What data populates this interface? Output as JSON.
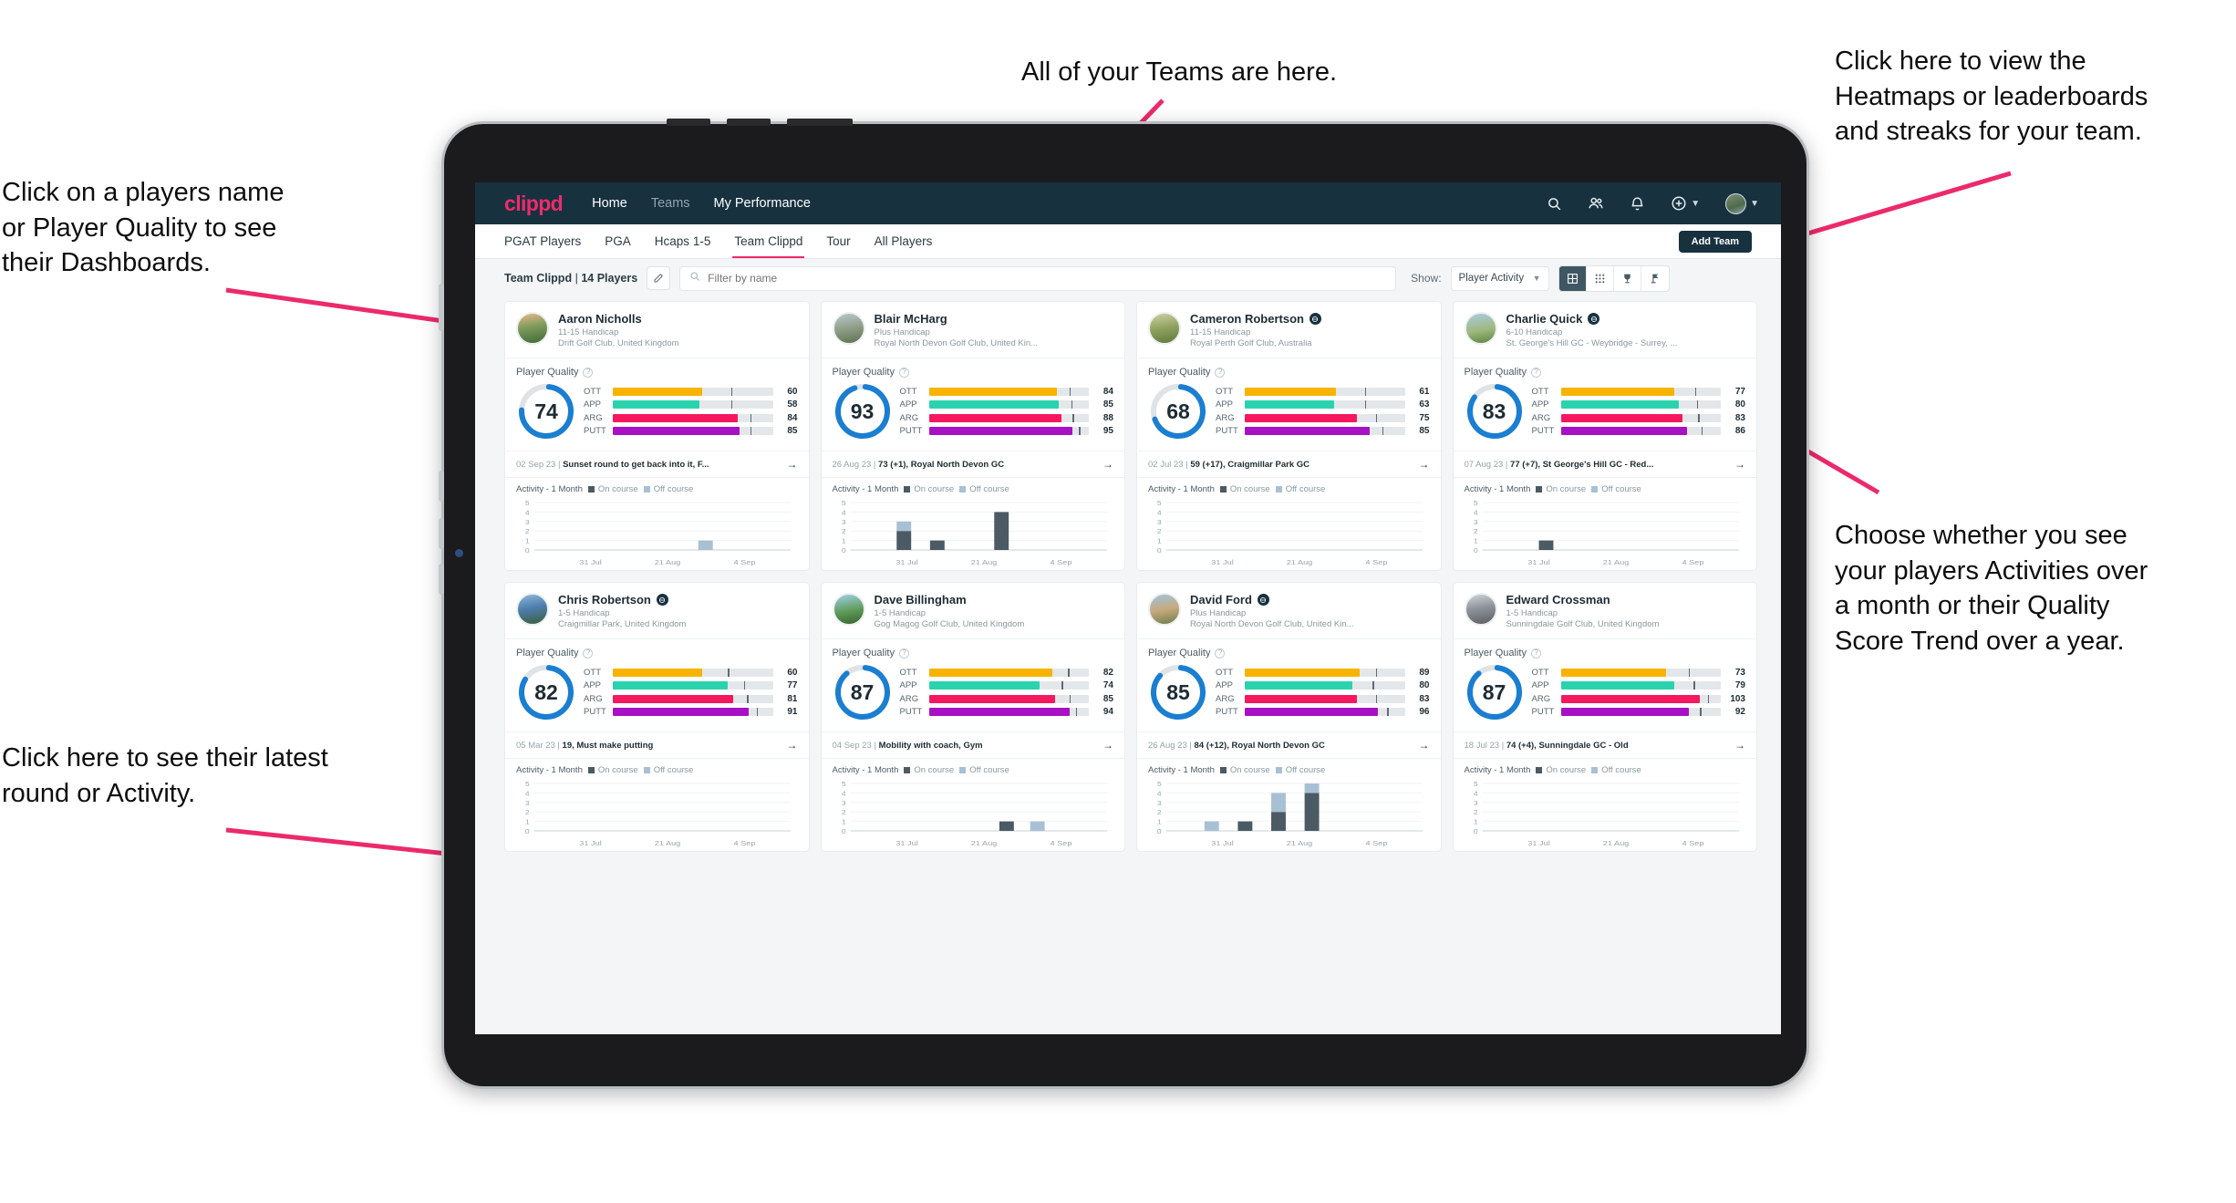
{
  "annotations": [
    {
      "id": "players-name",
      "text": "Click on a players name\nor Player Quality to see\ntheir Dashboards."
    },
    {
      "id": "teams",
      "text": "All of your Teams are here."
    },
    {
      "id": "heatmaps",
      "text": "Click here to view the\nHeatmaps or leaderboards\nand streaks for your team."
    },
    {
      "id": "activity-toggle",
      "text": "Choose whether you see\nyour players Activities over\na month or their Quality\nScore Trend over a year."
    },
    {
      "id": "latest-round",
      "text": "Click here to see their latest\nround or Activity."
    }
  ],
  "app": {
    "logo": "clippd",
    "nav": [
      {
        "label": "Home",
        "active": true
      },
      {
        "label": "Teams",
        "active": false
      },
      {
        "label": "My Performance",
        "active": true
      }
    ],
    "icons": [
      "search-icon",
      "people-icon",
      "bell-icon",
      "plus-circle-icon",
      "avatar"
    ],
    "tabs": [
      {
        "label": "PGAT Players",
        "state": "normal"
      },
      {
        "label": "PGA",
        "state": "normal"
      },
      {
        "label": "Hcaps 1-5",
        "state": "normal"
      },
      {
        "label": "Team Clippd",
        "state": "active"
      },
      {
        "label": "Tour",
        "state": "normal"
      },
      {
        "label": "All Players",
        "state": "normal"
      }
    ],
    "add_team_label": "Add Team",
    "filterbar": {
      "team_name": "Team Clippd",
      "team_count": "14 Players",
      "search_placeholder": "Filter by name",
      "search_value": "",
      "show_label": "Show:",
      "show_value": "Player Activity",
      "view_modes": [
        "grid-large-icon",
        "grid-small-icon",
        "trophy-icon",
        "flag-icon"
      ],
      "active_view": 0
    }
  },
  "card_labels": {
    "player_quality": "Player Quality",
    "activity": "Activity - 1 Month",
    "legend_on": "On course",
    "legend_off": "Off course"
  },
  "metric_colors": {
    "OTT": "#f7b300",
    "APP": "#2ad3ae",
    "ARG": "#f5185f",
    "PUTT": "#a810c4",
    "ring": "#1a7ed1",
    "ring_track": "#dfe3e6",
    "on_course": "#4b5a63",
    "off_course": "#a8c0d4"
  },
  "chart_data": {
    "type": "bar",
    "title": "Activity - 1 Month",
    "categories": [
      "31 Jul",
      "21 Aug",
      "4 Sep"
    ],
    "ylim": [
      0,
      5
    ],
    "ylabel": "",
    "xlabel": "",
    "grid": true,
    "legend": [
      "On course",
      "Off course"
    ],
    "series_note": "stacked bars per weekly bucket; each player card has its own bars"
  },
  "players": [
    {
      "name": "Aaron Nicholls",
      "badge": false,
      "handicap": "11-15 Handicap",
      "club": "Drift Golf Club, United Kingdom",
      "quality": 74,
      "metrics": [
        {
          "label": "OTT",
          "value": 60,
          "fill": 56,
          "tick": 74
        },
        {
          "label": "APP",
          "value": 58,
          "fill": 54,
          "tick": 74
        },
        {
          "label": "ARG",
          "value": 84,
          "fill": 78,
          "tick": 86
        },
        {
          "label": "PUTT",
          "value": 85,
          "fill": 79,
          "tick": 86
        }
      ],
      "latest_date": "02 Sep 23",
      "latest_text": "Sunset round to get back into it, F...",
      "bars": [
        {
          "x": 64,
          "on": 0,
          "off": 1
        }
      ]
    },
    {
      "name": "Blair McHarg",
      "badge": false,
      "handicap": "Plus Handicap",
      "club": "Royal North Devon Golf Club, United Kin...",
      "quality": 93,
      "metrics": [
        {
          "label": "OTT",
          "value": 84,
          "fill": 80,
          "tick": 88
        },
        {
          "label": "APP",
          "value": 85,
          "fill": 81,
          "tick": 89
        },
        {
          "label": "ARG",
          "value": 88,
          "fill": 83,
          "tick": 90
        },
        {
          "label": "PUTT",
          "value": 95,
          "fill": 90,
          "tick": 94
        }
      ],
      "latest_date": "26 Aug 23",
      "latest_text": "73 (+1), Royal North Devon GC",
      "bars": [
        {
          "x": 18,
          "on": 2,
          "off": 1
        },
        {
          "x": 31,
          "on": 1,
          "off": 0
        },
        {
          "x": 56,
          "on": 4,
          "off": 0
        }
      ]
    },
    {
      "name": "Cameron Robertson",
      "badge": true,
      "handicap": "11-15 Handicap",
      "club": "Royal Perth Golf Club, Australia",
      "quality": 68,
      "metrics": [
        {
          "label": "OTT",
          "value": 61,
          "fill": 57,
          "tick": 75
        },
        {
          "label": "APP",
          "value": 63,
          "fill": 56,
          "tick": 75
        },
        {
          "label": "ARG",
          "value": 75,
          "fill": 70,
          "tick": 82
        },
        {
          "label": "PUTT",
          "value": 85,
          "fill": 78,
          "tick": 86
        }
      ],
      "latest_date": "02 Jul 23",
      "latest_text": "59 (+17), Craigmillar Park GC",
      "bars": []
    },
    {
      "name": "Charlie Quick",
      "badge": true,
      "handicap": "6-10 Handicap",
      "club": "St. George's Hill GC - Weybridge - Surrey, ...",
      "quality": 83,
      "metrics": [
        {
          "label": "OTT",
          "value": 77,
          "fill": 71,
          "tick": 84
        },
        {
          "label": "APP",
          "value": 80,
          "fill": 74,
          "tick": 85
        },
        {
          "label": "ARG",
          "value": 83,
          "fill": 76,
          "tick": 86
        },
        {
          "label": "PUTT",
          "value": 86,
          "fill": 79,
          "tick": 88
        }
      ],
      "latest_date": "07 Aug 23",
      "latest_text": "77 (+7), St George's Hill GC - Red...",
      "bars": [
        {
          "x": 22,
          "on": 1,
          "off": 0
        }
      ]
    },
    {
      "name": "Chris Robertson",
      "badge": true,
      "handicap": "1-5 Handicap",
      "club": "Craigmillar Park, United Kingdom",
      "quality": 82,
      "metrics": [
        {
          "label": "OTT",
          "value": 60,
          "fill": 56,
          "tick": 72
        },
        {
          "label": "APP",
          "value": 77,
          "fill": 72,
          "tick": 82
        },
        {
          "label": "ARG",
          "value": 81,
          "fill": 75,
          "tick": 84
        },
        {
          "label": "PUTT",
          "value": 91,
          "fill": 85,
          "tick": 90
        }
      ],
      "latest_date": "05 Mar 23",
      "latest_text": "19, Must make putting",
      "bars": []
    },
    {
      "name": "Dave Billingham",
      "badge": false,
      "handicap": "1-5 Handicap",
      "club": "Gog Magog Golf Club, United Kingdom",
      "quality": 87,
      "metrics": [
        {
          "label": "OTT",
          "value": 82,
          "fill": 77,
          "tick": 87
        },
        {
          "label": "APP",
          "value": 74,
          "fill": 69,
          "tick": 83
        },
        {
          "label": "ARG",
          "value": 85,
          "fill": 79,
          "tick": 88
        },
        {
          "label": "PUTT",
          "value": 94,
          "fill": 88,
          "tick": 92
        }
      ],
      "latest_date": "04 Sep 23",
      "latest_text": "Mobility with coach, Gym",
      "bars": [
        {
          "x": 58,
          "on": 1,
          "off": 0
        },
        {
          "x": 70,
          "on": 0,
          "off": 1
        }
      ]
    },
    {
      "name": "David Ford",
      "badge": true,
      "handicap": "Plus Handicap",
      "club": "Royal North Devon Golf Club, United Kin...",
      "quality": 85,
      "metrics": [
        {
          "label": "OTT",
          "value": 89,
          "fill": 72,
          "tick": 82
        },
        {
          "label": "APP",
          "value": 80,
          "fill": 67,
          "tick": 80
        },
        {
          "label": "ARG",
          "value": 83,
          "fill": 70,
          "tick": 82
        },
        {
          "label": "PUTT",
          "value": 96,
          "fill": 83,
          "tick": 89
        }
      ],
      "latest_date": "26 Aug 23",
      "latest_text": "84 (+12), Royal North Devon GC",
      "bars": [
        {
          "x": 15,
          "on": 0,
          "off": 1
        },
        {
          "x": 28,
          "on": 1,
          "off": 0
        },
        {
          "x": 41,
          "on": 2,
          "off": 2
        },
        {
          "x": 54,
          "on": 4,
          "off": 1
        }
      ]
    },
    {
      "name": "Edward Crossman",
      "badge": false,
      "handicap": "1-5 Handicap",
      "club": "Sunningdale Golf Club, United Kingdom",
      "quality": 87,
      "metrics": [
        {
          "label": "OTT",
          "value": 73,
          "fill": 66,
          "tick": 80
        },
        {
          "label": "APP",
          "value": 79,
          "fill": 71,
          "tick": 83
        },
        {
          "label": "ARG",
          "value": 103,
          "fill": 87,
          "tick": 92
        },
        {
          "label": "PUTT",
          "value": 92,
          "fill": 80,
          "tick": 87
        }
      ],
      "latest_date": "18 Jul 23",
      "latest_text": "74 (+4), Sunningdale GC - Old",
      "bars": []
    }
  ]
}
